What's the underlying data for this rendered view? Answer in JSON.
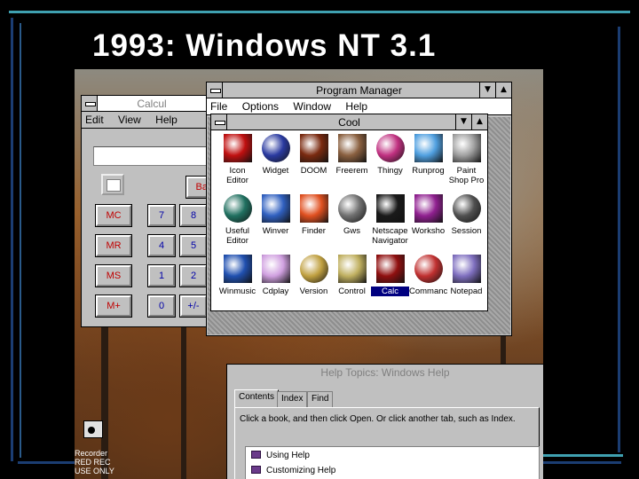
{
  "slide": {
    "title": "1993: Windows NT 3.1"
  },
  "calculator": {
    "title": "Calcul",
    "menu": [
      "Edit",
      "View",
      "Help"
    ],
    "back_label": "Bac",
    "memory_buttons": [
      "MC",
      "MR",
      "MS",
      "M+"
    ],
    "number_rows": [
      [
        "7",
        "8"
      ],
      [
        "4",
        "5"
      ],
      [
        "1",
        "2"
      ],
      [
        "0",
        "+/-"
      ]
    ]
  },
  "program_manager": {
    "title": "Program Manager",
    "menu": [
      "File",
      "Options",
      "Window",
      "Help"
    ],
    "group": {
      "title": "Cool",
      "icons": [
        {
          "label": "Icon\nEditor",
          "color": "#c01010"
        },
        {
          "label": "Widget",
          "color": "#2a3aa0"
        },
        {
          "label": "DOOM",
          "color": "#7a2a10"
        },
        {
          "label": "Freerem",
          "color": "#8a6040"
        },
        {
          "label": "Thingy",
          "color": "#c03080"
        },
        {
          "label": "Runprog",
          "color": "#50a0e0"
        },
        {
          "label": "Paint\nShop Pro",
          "color": "#a0a0a0"
        },
        {
          "label": "Useful\nEditor",
          "color": "#207060"
        },
        {
          "label": "Winver",
          "color": "#3060c0"
        },
        {
          "label": "Finder",
          "color": "#e05020"
        },
        {
          "label": "Gws",
          "color": "#707070"
        },
        {
          "label": "Netscape\nNavigator",
          "color": "#1a1a1a"
        },
        {
          "label": "Worksho",
          "color": "#902090"
        },
        {
          "label": "Session",
          "color": "#505050"
        },
        {
          "label": "Winmusic",
          "color": "#2050b0"
        },
        {
          "label": "Cdplay",
          "color": "#d0a0e0"
        },
        {
          "label": "Version",
          "color": "#c0a040"
        },
        {
          "label": "Control",
          "color": "#c0b060"
        },
        {
          "label": "Calc",
          "color": "#901010"
        },
        {
          "label": "Commanc",
          "color": "#c03030"
        },
        {
          "label": "Notepad",
          "color": "#8070c0"
        }
      ],
      "selected": "Calc"
    }
  },
  "help": {
    "title": "Help Topics: Windows Help",
    "tabs": [
      "Contents",
      "Index",
      "Find"
    ],
    "instruction": "Click a book, and then click Open. Or click another tab, such as Index.",
    "items": [
      "Using Help",
      "Customizing Help"
    ]
  },
  "recorder": {
    "lines": [
      "Recorder",
      "RED REC",
      "USE ONLY"
    ]
  }
}
